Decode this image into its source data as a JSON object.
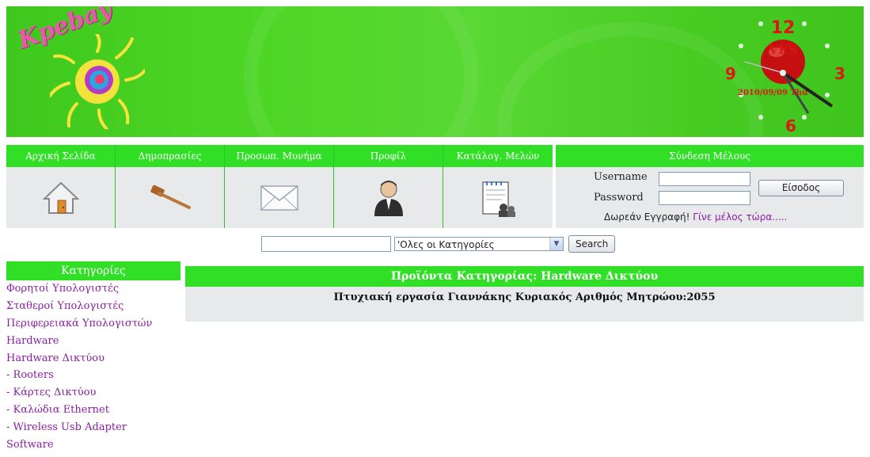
{
  "banner": {
    "logo_text": "Kpebay",
    "clock": {
      "numerals": [
        "12",
        "3",
        "6",
        "9"
      ],
      "center_text": "VES",
      "date": "2010/09/09 Thu"
    }
  },
  "nav": {
    "items": [
      {
        "label": "Αρχική Σελίδα",
        "icon": "home-icon"
      },
      {
        "label": "Δημοπρασίες",
        "icon": "gavel-icon"
      },
      {
        "label": "Προσωπ. Μυνήμα",
        "icon": "envelope-icon"
      },
      {
        "label": "Προφίλ",
        "icon": "user-icon"
      },
      {
        "label": "Κατάλογ. Μελών",
        "icon": "members-list-icon"
      }
    ]
  },
  "login": {
    "title": "Σύνδεση Μέλους",
    "username_label": "Username",
    "password_label": "Password",
    "username_value": "",
    "password_value": "",
    "submit_label": "Είσοδος",
    "register_text": "Δωρεάν Εγγραφή!",
    "register_link": "Γίνε μέλος τώρα....."
  },
  "search": {
    "query_value": "",
    "category_selected": "'Ολες οι Κατηγορίες",
    "button_label": "Search"
  },
  "sidebar": {
    "title": "Κατηγορίες",
    "categories": [
      "Φορητοί Υπολογιστές",
      "Σταθεροί Υπολογιστές",
      "Περιφερειακά Υπολογιστών",
      "Hardware",
      "Hardware Δικτύου",
      "- Rooters",
      "- Κάρτες Δικτύου",
      "- Καλώδια Ethernet",
      "- Wireless Usb Adapter",
      "Software"
    ]
  },
  "main": {
    "title": "Προϊόντα Κατηγορίας: Hardware Δικτύου",
    "notice": "Πτυχιακή εργασία Γιαννάκης Κυριακός Αριθμός Μητρώου:2055"
  },
  "colors": {
    "accent_green": "#31e026",
    "panel_gray": "#e7e9ea",
    "link_purple": "#8a1ea0",
    "clock_red": "#d81a12"
  }
}
